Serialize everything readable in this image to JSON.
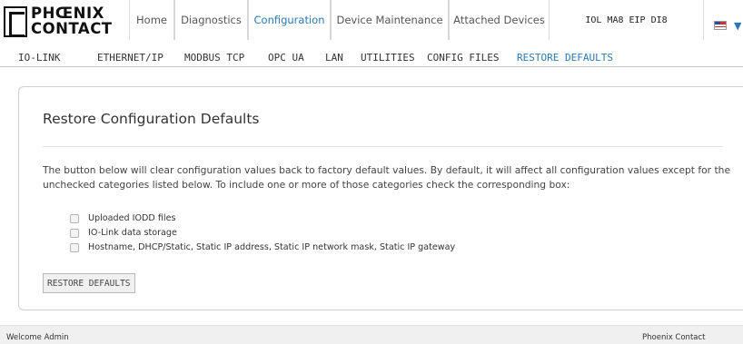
{
  "brand": {
    "line1": "PHŒNIX",
    "line2": "CONTACT"
  },
  "top_nav": {
    "tabs": [
      {
        "label": "Home"
      },
      {
        "label": "Diagnostics"
      },
      {
        "label": "Configuration",
        "active": true
      },
      {
        "label": "Device Maintenance"
      },
      {
        "label": "Attached Devices"
      }
    ],
    "device_name": "IOL MA8 EIP DI8",
    "language_icon": "us-flag-icon"
  },
  "sub_nav": {
    "items": [
      {
        "label": "IO-LINK"
      },
      {
        "label": "ETHERNET/IP"
      },
      {
        "label": "MODBUS TCP"
      },
      {
        "label": "OPC UA"
      },
      {
        "label": "LAN"
      },
      {
        "label": "UTILITIES"
      },
      {
        "label": "CONFIG FILES"
      },
      {
        "label": "RESTORE DEFAULTS",
        "active": true
      }
    ]
  },
  "panel": {
    "title": "Restore Configuration Defaults",
    "description": "The button below will clear configuration values back to factory default values. By default, it will affect all configuration values except for the unchecked categories listed below. To include one or more of those categories check the corresponding box:",
    "options": [
      {
        "label": "Uploaded IODD files",
        "checked": false
      },
      {
        "label": "IO-Link data storage",
        "checked": false
      },
      {
        "label": "Hostname, DHCP/Static, Static IP address, Static IP network mask, Static IP gateway",
        "checked": false
      }
    ],
    "button_label": "RESTORE DEFAULTS"
  },
  "footer": {
    "left": "Welcome Admin",
    "right": "Phoenix Contact"
  },
  "colors": {
    "accent": "#2a78b5",
    "border": "#cfcfcf",
    "footer_bg": "#f0f0f0"
  }
}
